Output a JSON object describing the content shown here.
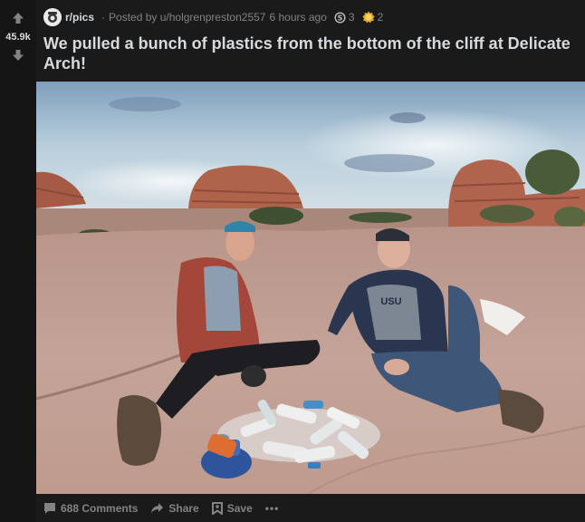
{
  "post": {
    "subreddit": "r/pics",
    "posted_by": "Posted by u/holgrenpreston2557",
    "time_ago": "6 hours ago",
    "score": "45.9k",
    "title": "We pulled a bunch of plastics from the bottom of the cliff at Delicate Arch!",
    "awards": [
      {
        "icon": "silver-award-icon",
        "count": "3"
      },
      {
        "icon": "gold-award-icon",
        "count": "2"
      }
    ]
  },
  "footer": {
    "comments_label": "688 Comments",
    "share_label": "Share",
    "save_label": "Save",
    "more_label": "•••"
  },
  "image": {
    "subject": "two people sitting on sandstone next to a pile of plastic bottles",
    "sweatshirt_text": "USU"
  },
  "colors": {
    "background": "#1a1a1b",
    "vote_column": "#151516",
    "text_primary": "#d7dadc",
    "text_secondary": "#818384"
  }
}
